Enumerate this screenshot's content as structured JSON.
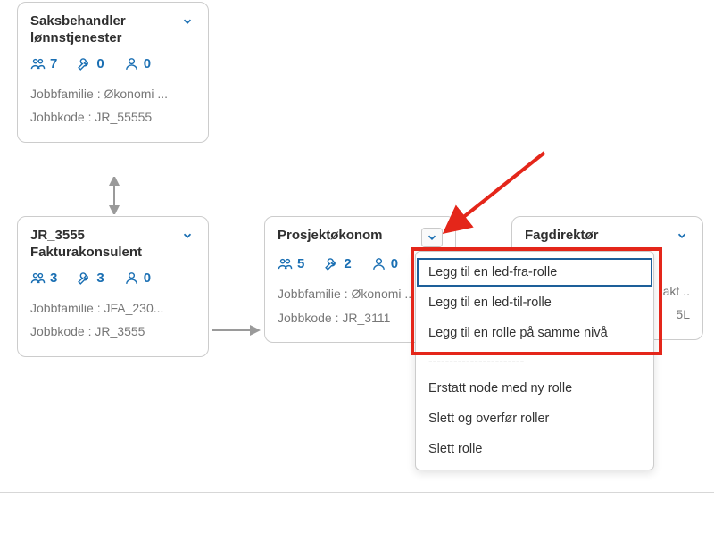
{
  "cards": {
    "top": {
      "title": "Saksbehandler lønnstjenester",
      "stats": {
        "people": "7",
        "tools": "0",
        "users": "0"
      },
      "family": "Jobbfamilie : Økonomi ...",
      "code": "Jobbkode : JR_55555"
    },
    "left": {
      "title": "JR_3555 Fakturakonsulent",
      "stats": {
        "people": "3",
        "tools": "3",
        "users": "0"
      },
      "family": "Jobbfamilie : JFA_230...",
      "code": "Jobbkode : JR_3555"
    },
    "mid": {
      "title": "Prosjektøkonom",
      "stats": {
        "people": "5",
        "tools": "2",
        "users": "0"
      },
      "family": "Jobbfamilie : Økonomi ...",
      "code": "Jobbkode : JR_3111"
    },
    "right": {
      "title": "Fagdirektør",
      "trail1": "akt ..",
      "trail2": "5L"
    }
  },
  "dropdown": {
    "item1": "Legg til en led-fra-rolle",
    "item2": "Legg til en led-til-rolle",
    "item3": "Legg til en rolle på samme nivå",
    "divider": "-----------------------",
    "item4": "Erstatt node med ny rolle",
    "item5": "Slett og overfør roller",
    "item6": "Slett rolle"
  },
  "chart_data": {
    "type": "diagram",
    "title": "Role hierarchy / org chart nodes with context menu",
    "nodes": [
      {
        "id": "saksbehandler",
        "label": "Saksbehandler lønnstjenester",
        "jobbfamilie": "Økonomi",
        "jobbkode": "JR_55555",
        "counts": {
          "incumbents": 7,
          "positions": 0,
          "users": 0
        }
      },
      {
        "id": "fakturakonsulent",
        "label": "JR_3555 Fakturakonsulent",
        "jobbfamilie": "JFA_230",
        "jobbkode": "JR_3555",
        "counts": {
          "incumbents": 3,
          "positions": 3,
          "users": 0
        }
      },
      {
        "id": "prosjektokonom",
        "label": "Prosjektøkonom",
        "jobbfamilie": "Økonomi",
        "jobbkode": "JR_3111",
        "counts": {
          "incumbents": 5,
          "positions": 2,
          "users": 0
        }
      },
      {
        "id": "fagdirektor",
        "label": "Fagdirektør"
      }
    ],
    "edges": [
      {
        "from": "saksbehandler",
        "to": "fakturakonsulent",
        "style": "bidirectional-vertical"
      },
      {
        "from": "fakturakonsulent",
        "to": "prosjektokonom",
        "style": "arrow-right"
      }
    ],
    "context_menu_open_on": "prosjektokonom",
    "context_menu_items": [
      "Legg til en led-fra-rolle",
      "Legg til en led-til-rolle",
      "Legg til en rolle på samme nivå",
      "Erstatt node med ny rolle",
      "Slett og overfør roller",
      "Slett rolle"
    ],
    "annotations": [
      {
        "type": "red-arrow",
        "points_to": "chevron of Prosjektøkonom"
      },
      {
        "type": "red-box",
        "around": "first three context-menu items"
      }
    ]
  }
}
